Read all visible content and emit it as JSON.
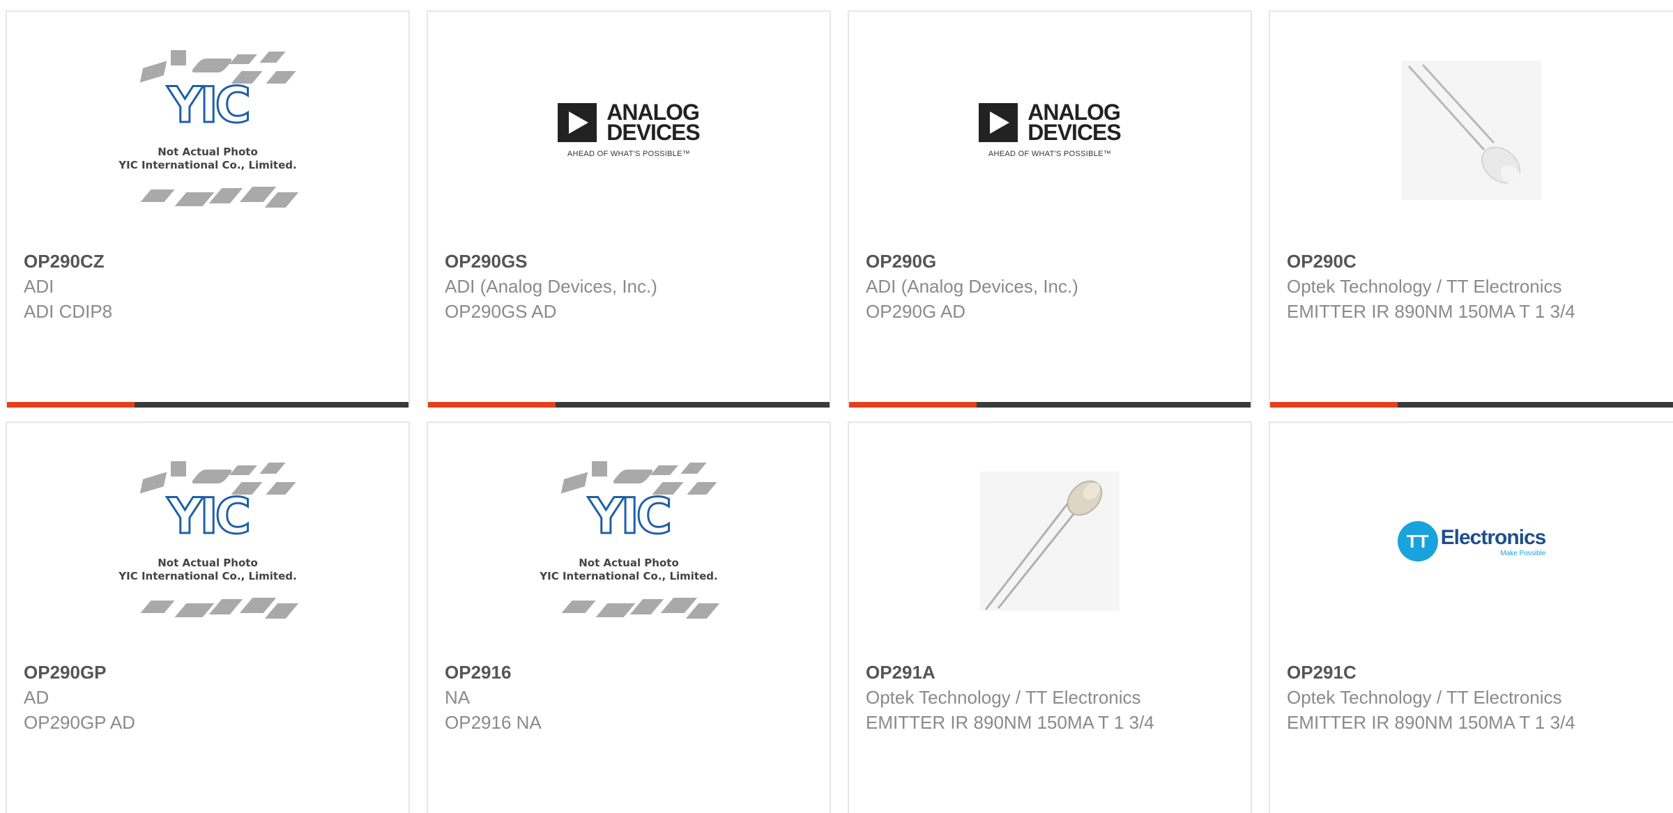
{
  "products": [
    {
      "part": "OP290CZ",
      "manufacturer": "ADI",
      "description": "ADI CDIP8",
      "image": "yic-placeholder"
    },
    {
      "part": "OP290GS",
      "manufacturer": "ADI (Analog Devices, Inc.)",
      "description": "OP290GS AD",
      "image": "analog-devices-logo"
    },
    {
      "part": "OP290G",
      "manufacturer": "ADI (Analog Devices, Inc.)",
      "description": "OP290G AD",
      "image": "analog-devices-logo"
    },
    {
      "part": "OP290C",
      "manufacturer": "Optek Technology / TT Electronics",
      "description": "EMITTER IR 890NM 150MA T 1 3/4",
      "image": "led-photo"
    },
    {
      "part": "OP290GP",
      "manufacturer": "AD",
      "description": "OP290GP AD",
      "image": "yic-placeholder"
    },
    {
      "part": "OP2916",
      "manufacturer": "NA",
      "description": "OP2916 NA",
      "image": "yic-placeholder"
    },
    {
      "part": "OP291A",
      "manufacturer": "Optek Technology / TT Electronics",
      "description": "EMITTER IR 890NM 150MA T 1 3/4",
      "image": "led-photo"
    },
    {
      "part": "OP291C",
      "manufacturer": "Optek Technology / TT Electronics",
      "description": "EMITTER IR 890NM 150MA T 1 3/4",
      "image": "tt-electronics-logo"
    }
  ],
  "yic": {
    "logo": "YIC",
    "caption_line1": "Not Actual Photo",
    "caption_line2": "YIC International Co., Limited."
  },
  "adi_logo": {
    "line1": "ANALOG",
    "line2": "DEVICES",
    "tagline": "AHEAD OF WHAT'S POSSIBLE™"
  },
  "tt_logo": {
    "mark": "TT",
    "name": "Electronics",
    "tagline": "Make Possible"
  },
  "colors": {
    "accent": "#e4401b",
    "bar": "#3a3a3a",
    "border": "#e6e6e6",
    "part_text": "#555555",
    "meta_text": "#8a8a8a"
  }
}
